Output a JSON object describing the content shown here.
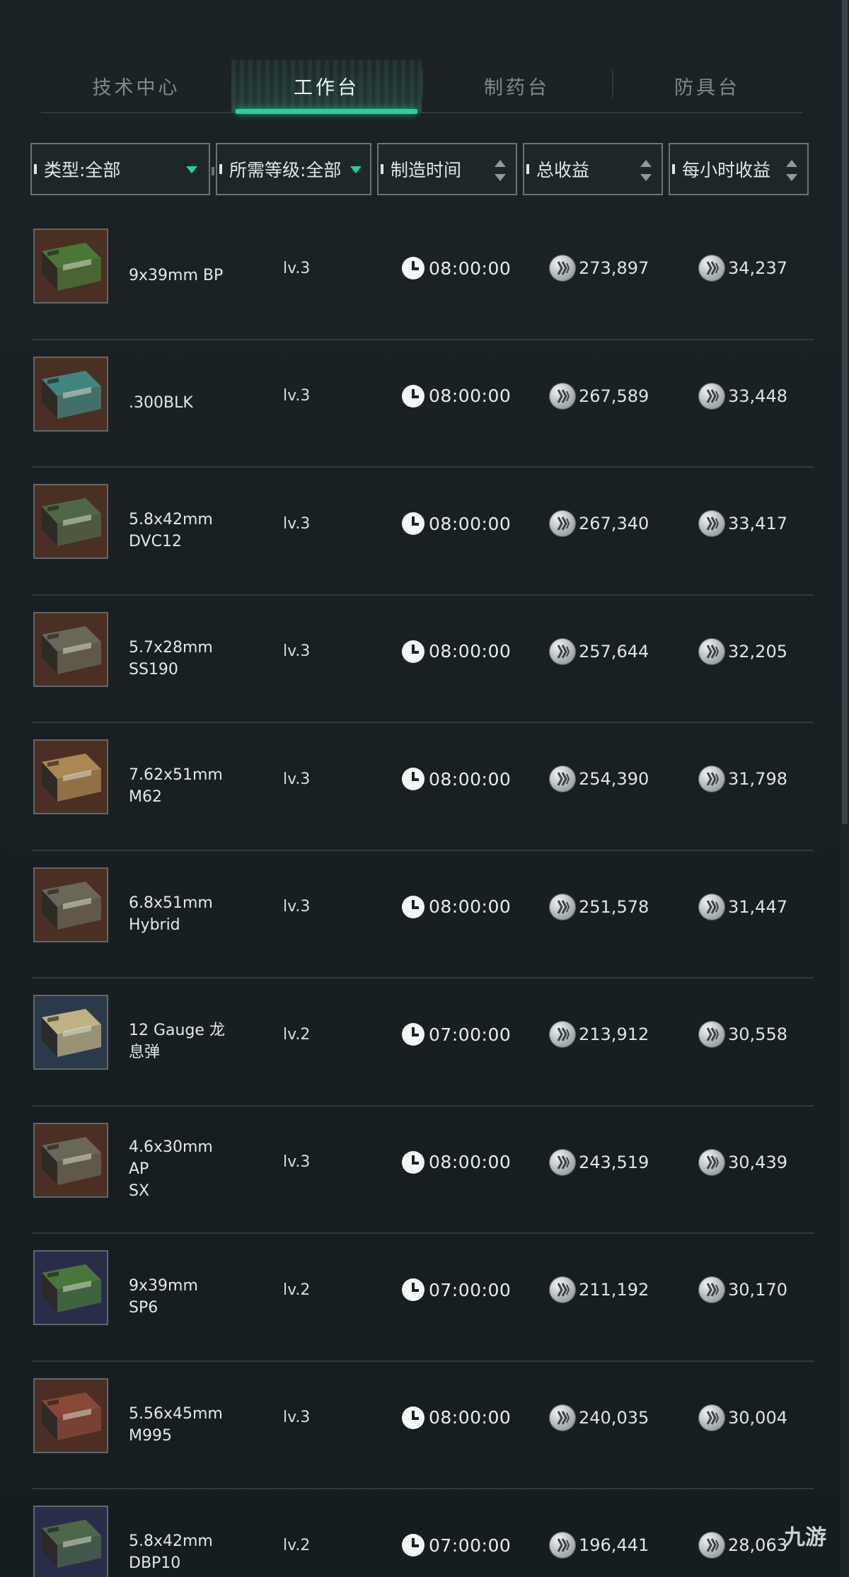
{
  "tabs": [
    {
      "label": "技术中心",
      "active": false
    },
    {
      "label": "工作台",
      "active": true
    },
    {
      "label": "制药台",
      "active": false
    },
    {
      "label": "防具台",
      "active": false
    }
  ],
  "filters": {
    "type": "类型:全部",
    "level": "所需等级:全部",
    "time": "制造时间",
    "total": "总收益",
    "hourly": "每小时收益"
  },
  "items": [
    {
      "name": "9x39mm BP",
      "level": "lv.3",
      "time": "08:00:00",
      "total": "273,897",
      "hourly": "34,237",
      "box_color": "#4a7a3a",
      "bg_color": "#4a2f22"
    },
    {
      "name": ".300BLK",
      "level": "lv.3",
      "time": "08:00:00",
      "total": "267,589",
      "hourly": "33,448",
      "box_color": "#3f8a86",
      "bg_color": "#4a2f22"
    },
    {
      "name": "5.8x42mm\nDVC12",
      "level": "lv.3",
      "time": "08:00:00",
      "total": "267,340",
      "hourly": "33,417",
      "box_color": "#4f6a48",
      "bg_color": "#4a2f22"
    },
    {
      "name": "5.7x28mm\nSS190",
      "level": "lv.3",
      "time": "08:00:00",
      "total": "257,644",
      "hourly": "32,205",
      "box_color": "#6a6a5a",
      "bg_color": "#4a2f22"
    },
    {
      "name": "7.62x51mm\nM62",
      "level": "lv.3",
      "time": "08:00:00",
      "total": "254,390",
      "hourly": "31,798",
      "box_color": "#b08c55",
      "bg_color": "#4a2f22"
    },
    {
      "name": "6.8x51mm\nHybrid",
      "level": "lv.3",
      "time": "08:00:00",
      "total": "251,578",
      "hourly": "31,447",
      "box_color": "#6a6a5a",
      "bg_color": "#4a2f22"
    },
    {
      "name": "12 Gauge 龙\n息弹",
      "level": "lv.2",
      "time": "07:00:00",
      "total": "213,912",
      "hourly": "30,558",
      "box_color": "#c8b888",
      "bg_color": "#2a3a4a"
    },
    {
      "name": "4.6x30mm AP\nSX",
      "level": "lv.3",
      "time": "08:00:00",
      "total": "243,519",
      "hourly": "30,439",
      "box_color": "#6a6a5a",
      "bg_color": "#4a2f22"
    },
    {
      "name": "9x39mm SP6",
      "level": "lv.2",
      "time": "07:00:00",
      "total": "211,192",
      "hourly": "30,170",
      "box_color": "#4a7a3a",
      "bg_color": "#2a2d4a"
    },
    {
      "name": "5.56x45mm\nM995",
      "level": "lv.3",
      "time": "08:00:00",
      "total": "240,035",
      "hourly": "30,004",
      "box_color": "#8a4a3a",
      "bg_color": "#4a2f22"
    },
    {
      "name": "5.8x42mm\nDBP10",
      "level": "lv.2",
      "time": "07:00:00",
      "total": "196,441",
      "hourly": "28,063",
      "box_color": "#4f6a48",
      "bg_color": "#2a2d4a"
    }
  ],
  "watermark": "九游",
  "colors": {
    "accent": "#1fd69a",
    "background": "#181f22",
    "divider": "#303a3d"
  }
}
